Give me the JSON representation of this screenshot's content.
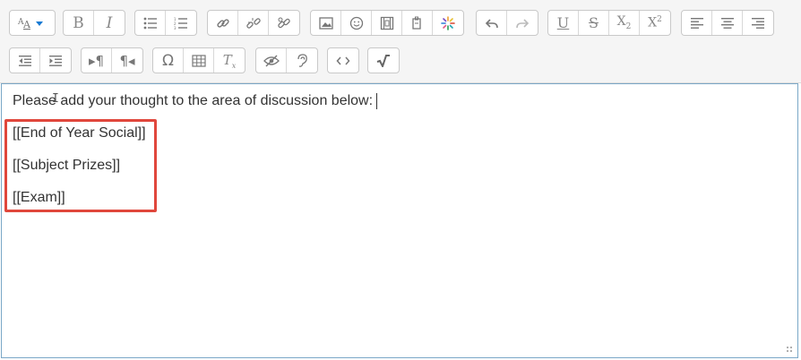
{
  "toolbar": {
    "row1": [
      {
        "group": "style",
        "buttons": [
          {
            "name": "paragraph-styles-icon",
            "glyph": "Aᴬ▾"
          }
        ]
      },
      {
        "group": "text",
        "buttons": [
          {
            "name": "bold-icon",
            "glyph": "B"
          },
          {
            "name": "italic-icon",
            "glyph": "I"
          }
        ]
      },
      {
        "group": "lists",
        "buttons": [
          {
            "name": "unordered-list-icon"
          },
          {
            "name": "ordered-list-icon"
          }
        ]
      },
      {
        "group": "links",
        "buttons": [
          {
            "name": "link-icon"
          },
          {
            "name": "unlink-icon"
          },
          {
            "name": "auto-link-icon"
          }
        ]
      },
      {
        "group": "media",
        "buttons": [
          {
            "name": "image-icon"
          },
          {
            "name": "emoticon-icon"
          },
          {
            "name": "media-icon"
          },
          {
            "name": "manage-files-icon"
          },
          {
            "name": "recordrtc-icon"
          }
        ]
      },
      {
        "group": "undo",
        "buttons": [
          {
            "name": "undo-icon"
          },
          {
            "name": "redo-icon"
          }
        ]
      },
      {
        "group": "format",
        "buttons": [
          {
            "name": "underline-icon"
          },
          {
            "name": "strikethrough-icon"
          },
          {
            "name": "subscript-icon"
          },
          {
            "name": "superscript-icon"
          }
        ]
      },
      {
        "group": "align",
        "buttons": [
          {
            "name": "align-left-icon"
          },
          {
            "name": "align-center-icon"
          },
          {
            "name": "align-right-icon"
          }
        ]
      }
    ],
    "row2": [
      {
        "group": "indent",
        "buttons": [
          {
            "name": "outdent-icon"
          },
          {
            "name": "indent-icon"
          }
        ]
      },
      {
        "group": "direction",
        "buttons": [
          {
            "name": "ltr-icon"
          },
          {
            "name": "rtl-icon"
          }
        ]
      },
      {
        "group": "insert",
        "buttons": [
          {
            "name": "special-character-icon"
          },
          {
            "name": "table-icon"
          },
          {
            "name": "clear-formatting-icon"
          }
        ]
      },
      {
        "group": "accessibility",
        "buttons": [
          {
            "name": "accessibility-checker-icon"
          },
          {
            "name": "screenreader-helper-icon"
          }
        ]
      },
      {
        "group": "html",
        "buttons": [
          {
            "name": "html-source-icon"
          }
        ]
      },
      {
        "group": "math",
        "buttons": [
          {
            "name": "equation-editor-icon"
          }
        ]
      }
    ]
  },
  "editor": {
    "lines": [
      "Please add your thought to the area of discussion below:",
      "[[End of Year Social]]",
      "[[Subject Prizes]]",
      "[[Exam]]"
    ]
  },
  "colors": {
    "highlight": "#e0473c",
    "icon": "#7b7b7b",
    "emoticon_accent": "#f0a030"
  }
}
